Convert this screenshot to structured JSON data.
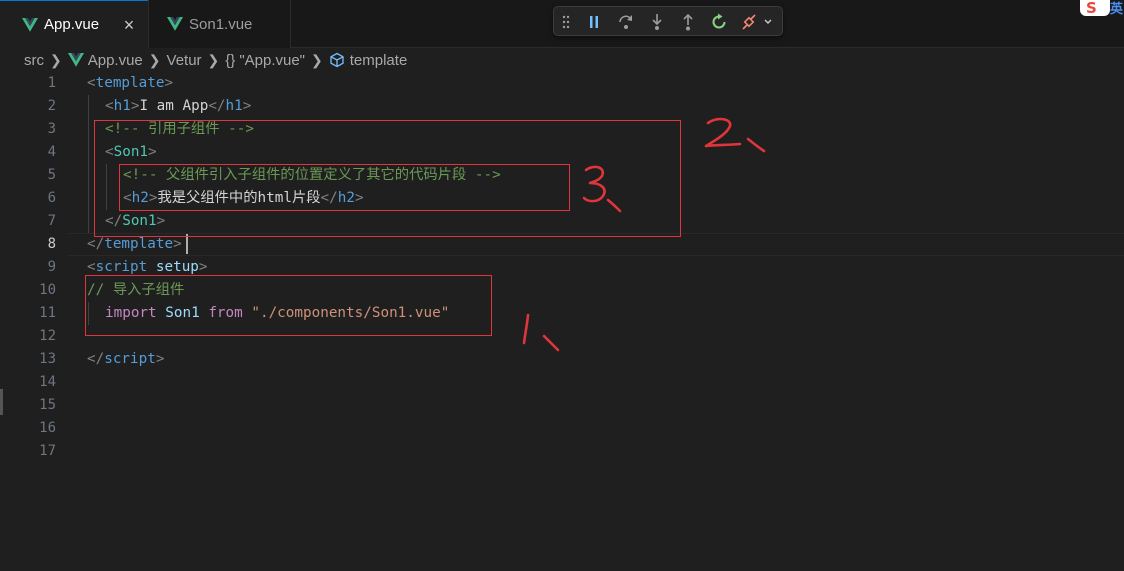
{
  "tabs": [
    {
      "label": "App.vue",
      "active": true
    },
    {
      "label": "Son1.vue",
      "active": false
    }
  ],
  "breadcrumb": {
    "items": [
      "src",
      "App.vue",
      "Vetur",
      "\"App.vue\"",
      "template"
    ],
    "braces": "{}"
  },
  "line_numbers": [
    "1",
    "2",
    "3",
    "4",
    "5",
    "6",
    "7",
    "8",
    "9",
    "10",
    "11",
    "12",
    "13",
    "14",
    "15",
    "16",
    "17"
  ],
  "current_line": "8",
  "code": {
    "l1": {
      "open": "<",
      "tag": "template",
      "close": ">"
    },
    "l2": {
      "open": "<",
      "tag": "h1",
      "close": ">",
      "text": "I am App",
      "eopen": "</",
      "etag": "h1",
      "eclose": ">"
    },
    "l3": {
      "comment": "<!-- 引用子组件 -->"
    },
    "l4": {
      "open": "<",
      "tag": "Son1",
      "close": ">"
    },
    "l5": {
      "comment": "<!-- 父组件引入子组件的位置定义了其它的代码片段 -->"
    },
    "l6": {
      "open": "<",
      "tag": "h2",
      "close": ">",
      "text": "我是父组件中的html片段",
      "eopen": "</",
      "etag": "h2",
      "eclose": ">"
    },
    "l7": {
      "open": "</",
      "tag": "Son1",
      "close": ">"
    },
    "l8": {
      "open": "</",
      "tag": "template",
      "close": ">"
    },
    "l9": {
      "open": "<",
      "tag": "script",
      "attr": "setup",
      "close": ">"
    },
    "l10": {
      "comment": "// 导入子组件"
    },
    "l11": {
      "kw_import": "import",
      "name": "Son1",
      "kw_from": "from",
      "path": "\"./components/Son1.vue\""
    },
    "l13": {
      "open": "</",
      "tag": "script",
      "close": ">"
    }
  },
  "annotations": [
    "1、",
    "2、",
    "3、"
  ],
  "colors": {
    "background": "#1f1f1f",
    "tag": "#569cd6",
    "component": "#4ec9b0",
    "comment": "#6a9955",
    "keyword": "#c586c0",
    "string": "#ce9178",
    "annotation": "#e0353b",
    "vue_green": "#41b883"
  }
}
